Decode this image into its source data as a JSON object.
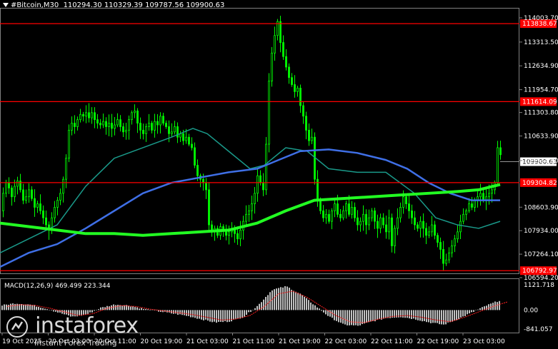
{
  "header": {
    "symbol": "#Bitcoin,M30",
    "ohlc": "110294.30 110329.39 109787.56 109900.63"
  },
  "price_axis": {
    "ticks": [
      "114003.70",
      "113313.50",
      "112634.90",
      "111954.70",
      "111303.80",
      "110633.90",
      "109934.00",
      "108603.90",
      "107934.00",
      "107264.10",
      "106594.20"
    ],
    "top": 114003.7,
    "bottom": 106594.2
  },
  "levels": [
    {
      "label": "113838.67",
      "value": 113838.67,
      "color": "#ff0000"
    },
    {
      "label": "111614.09",
      "value": 111614.09,
      "color": "#ff0000"
    },
    {
      "label": "109304.82",
      "value": 109304.82,
      "color": "#ff0000"
    },
    {
      "label": "106792.97",
      "value": 106792.97,
      "color": "#ff0000"
    }
  ],
  "current_price": {
    "label": "109900.63",
    "value": 109900.63
  },
  "time_axis": {
    "labels": [
      "19 Oct 2025",
      "20 Oct 03:00",
      "20 Oct 11:00",
      "20 Oct 19:00",
      "21 Oct 03:00",
      "21 Oct 11:00",
      "21 Oct 19:00",
      "22 Oct 03:00",
      "22 Oct 11:00",
      "22 Oct 19:00",
      "23 Oct 03:00"
    ]
  },
  "macd": {
    "title": "MACD(12,26,9) 469.499 223.344",
    "ticks": [
      "1121.718",
      "0.00",
      "-841.057"
    ],
    "max": 1121.718,
    "min": -841.057
  },
  "colors": {
    "candle": "#00ff00",
    "ma_fast": "#1a9a8a",
    "ma_mid": "#3f6fe6",
    "ma_slow": "#22ff22",
    "level": "#ff0000",
    "macd_hist": "#c0c0c0",
    "macd_signal": "#ff2020"
  },
  "logo": {
    "name": "instaforex",
    "tagline": "Instant Forex Trading"
  }
}
